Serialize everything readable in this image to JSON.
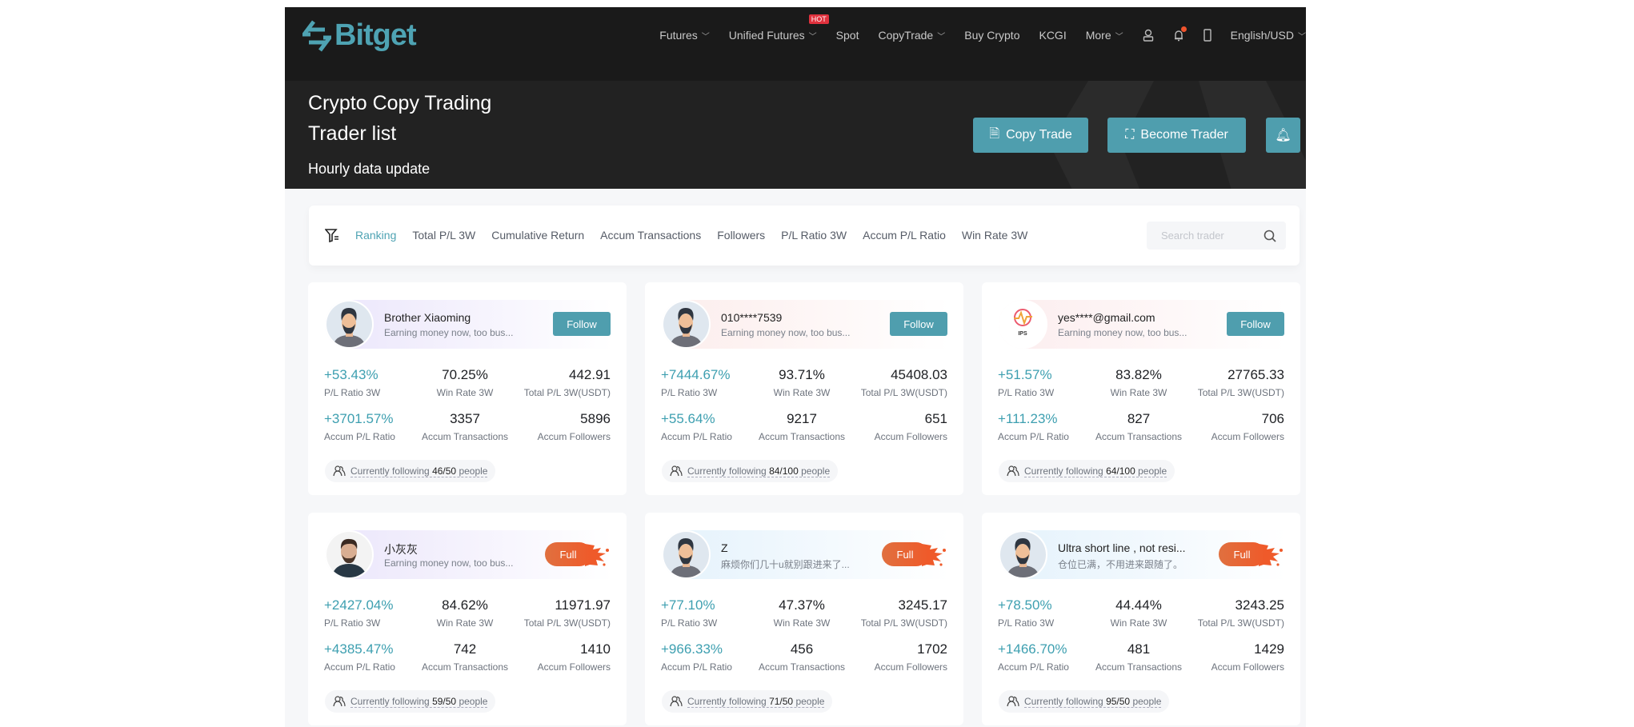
{
  "brand": {
    "name": "Bitget",
    "accent": "#4ea3b3"
  },
  "nav": {
    "items": [
      {
        "label": "Futures",
        "dropdown": true
      },
      {
        "label": "Unified Futures",
        "dropdown": true,
        "badge": "HOT"
      },
      {
        "label": "Spot",
        "dropdown": false
      },
      {
        "label": "CopyTrade",
        "dropdown": true
      },
      {
        "label": "Buy Crypto",
        "dropdown": false
      },
      {
        "label": "KCGI",
        "dropdown": false
      },
      {
        "label": "More",
        "dropdown": true
      }
    ],
    "language": "English/USD"
  },
  "hero": {
    "title": "Crypto Copy Trading",
    "subtitle": "Trader list",
    "note": "Hourly data update",
    "copy_trade": "Copy Trade",
    "become_trader": "Become Trader"
  },
  "filter": {
    "tabs": [
      "Ranking",
      "Total P/L 3W",
      "Cumulative Return",
      "Accum Transactions",
      "Followers",
      "P/L Ratio 3W",
      "Accum P/L Ratio",
      "Win Rate 3W"
    ],
    "active": "Ranking",
    "search_placeholder": "Search trader"
  },
  "labels": {
    "pl_ratio": "P/L Ratio 3W",
    "win_rate": "Win Rate 3W",
    "total_pl": "Total P/L 3W(USDT)",
    "accum_pl": "Accum P/L Ratio",
    "accum_tx": "Accum Transactions",
    "accum_followers": "Accum Followers",
    "following_prefix": "Currently following",
    "following_suffix": "people",
    "follow": "Follow",
    "full": "Full"
  },
  "traders": [
    {
      "name": "Brother Xiaoming",
      "bio": "Earning money now, too bus...",
      "status": "Follow",
      "avatar": "cartoon",
      "band": "#ebe6fb",
      "pl_ratio": "+53.43%",
      "win_rate": "70.25%",
      "total_pl": "442.91",
      "accum_pl": "+3701.57%",
      "accum_tx": "3357",
      "accum_followers": "5896",
      "following": "46/50"
    },
    {
      "name": "010****7539",
      "bio": "Earning money now, too bus...",
      "status": "Follow",
      "avatar": "cartoon",
      "band": "#fcedec",
      "pl_ratio": "+7444.67%",
      "win_rate": "93.71%",
      "total_pl": "45408.03",
      "accum_pl": "+55.64%",
      "accum_tx": "9217",
      "accum_followers": "651",
      "following": "84/100"
    },
    {
      "name": "yes****@gmail.com",
      "bio": "Earning money now, too bus...",
      "status": "Follow",
      "avatar": "ips",
      "avatar_text": "IPS",
      "band": "#fcedee",
      "pl_ratio": "+51.57%",
      "win_rate": "83.82%",
      "total_pl": "27765.33",
      "accum_pl": "+111.23%",
      "accum_tx": "827",
      "accum_followers": "706",
      "following": "64/100"
    },
    {
      "name": "小灰灰",
      "bio": "Earning money now, too bus...",
      "status": "Full",
      "avatar": "photo",
      "band": "#ebe6fb",
      "pl_ratio": "+2427.04%",
      "win_rate": "84.62%",
      "total_pl": "11971.97",
      "accum_pl": "+4385.47%",
      "accum_tx": "742",
      "accum_followers": "1410",
      "following": "59/50"
    },
    {
      "name": "Z",
      "bio": "麻烦你们几十u就别跟进来了...",
      "status": "Full",
      "avatar": "cartoon",
      "band": "#e4f2fc",
      "pl_ratio": "+77.10%",
      "win_rate": "47.37%",
      "total_pl": "3245.17",
      "accum_pl": "+966.33%",
      "accum_tx": "456",
      "accum_followers": "1702",
      "following": "71/50"
    },
    {
      "name": "Ultra short line , not resi...",
      "bio": "仓位已满，不用进来跟随了。",
      "status": "Full",
      "avatar": "cartoon",
      "band": "#e4f2fc",
      "pl_ratio": "+78.50%",
      "win_rate": "44.44%",
      "total_pl": "3243.25",
      "accum_pl": "+1466.70%",
      "accum_tx": "481",
      "accum_followers": "1429",
      "following": "95/50"
    }
  ]
}
